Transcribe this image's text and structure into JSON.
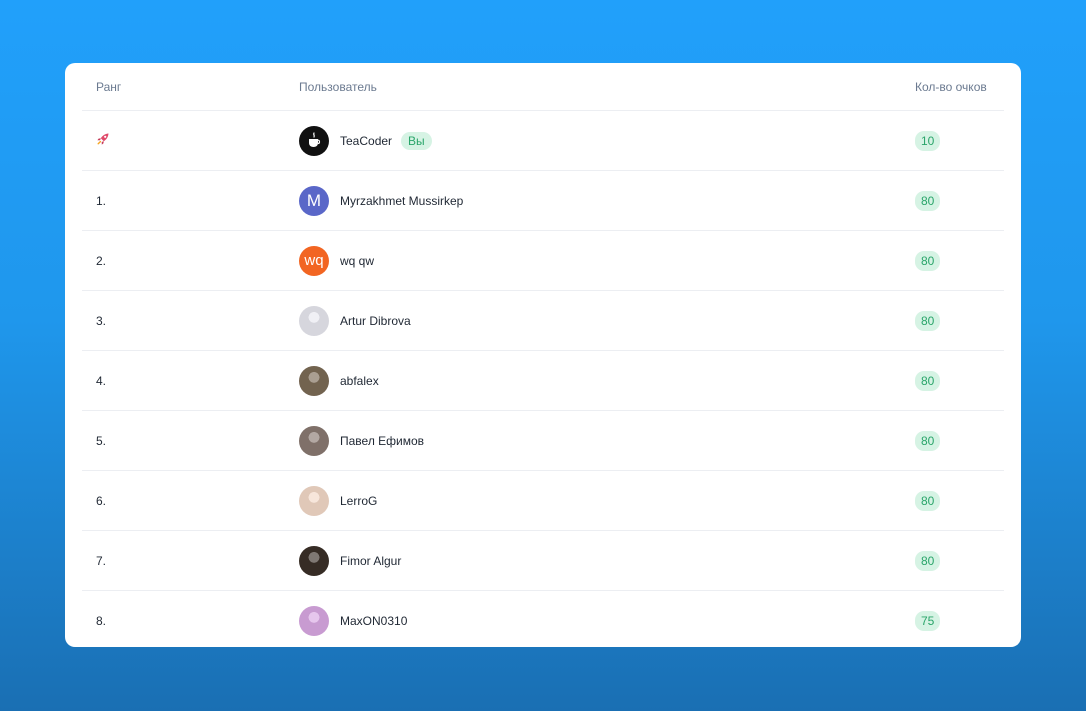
{
  "table": {
    "headers": {
      "rank": "Ранг",
      "user": "Пользователь",
      "score": "Кол-во очков"
    },
    "current_user": {
      "rank_icon": "rocket-icon",
      "name": "TeaCoder",
      "badge": "Вы",
      "score": "10",
      "avatar": {
        "type": "icon",
        "icon": "teacup-icon",
        "bg": "#111111"
      }
    },
    "rows": [
      {
        "rank": "1.",
        "name": "Myrzakhmet Mussirkep",
        "score": "80",
        "avatar": {
          "type": "letter",
          "text": "M",
          "bg": "#5a67c8",
          "fg": "#ffffff"
        }
      },
      {
        "rank": "2.",
        "name": "wq qw",
        "score": "80",
        "avatar": {
          "type": "letter",
          "text": "wq",
          "bg": "#f26522",
          "fg": "#ffffff"
        }
      },
      {
        "rank": "3.",
        "name": "Artur Dibrova",
        "score": "80",
        "avatar": {
          "type": "photo",
          "bg": "#e8e8f0"
        }
      },
      {
        "rank": "4.",
        "name": "abfalex",
        "score": "80",
        "avatar": {
          "type": "photo",
          "bg": "#7c6b56"
        }
      },
      {
        "rank": "5.",
        "name": "Павел Ефимов",
        "score": "80",
        "avatar": {
          "type": "photo",
          "bg": "#8a7a72"
        }
      },
      {
        "rank": "6.",
        "name": "LerroG",
        "score": "80",
        "avatar": {
          "type": "photo",
          "bg": "#f3d9c8"
        }
      },
      {
        "rank": "7.",
        "name": "Fimor Algur",
        "score": "80",
        "avatar": {
          "type": "photo",
          "bg": "#3b3028"
        }
      },
      {
        "rank": "8.",
        "name": "MaxON0310",
        "score": "75",
        "avatar": {
          "type": "photo",
          "bg": "#d9a8e3"
        }
      }
    ]
  }
}
